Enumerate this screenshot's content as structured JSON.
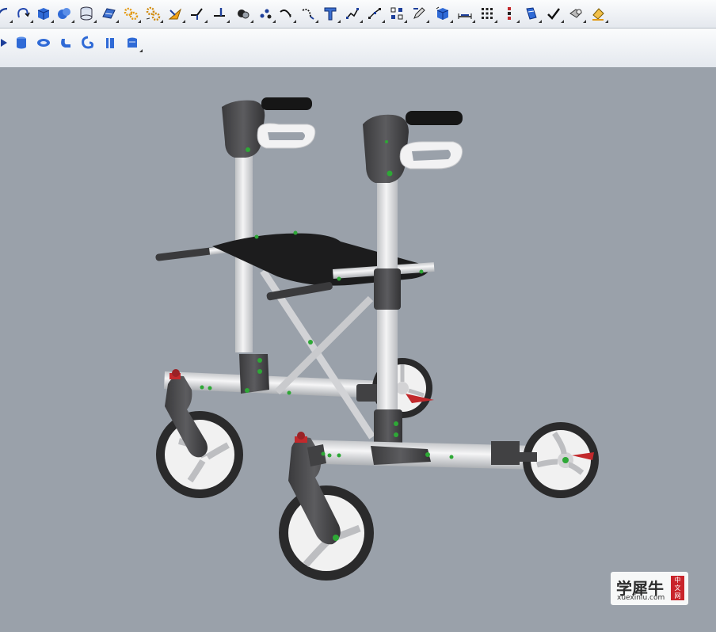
{
  "toolbar_top": {
    "tools": [
      {
        "icon": "curve-tool-icon"
      },
      {
        "icon": "revolve-icon"
      },
      {
        "icon": "box-solid-icon"
      },
      {
        "icon": "boolean-union-icon"
      },
      {
        "icon": "cylinder-solid-icon"
      },
      {
        "icon": "surface-edit-icon"
      },
      {
        "icon": "gear-transform-icon"
      },
      {
        "icon": "gear-array-icon"
      },
      {
        "icon": "fillet-edge-icon"
      },
      {
        "icon": "split-icon"
      },
      {
        "icon": "trim-icon"
      },
      {
        "icon": "boolean-difference-icon"
      },
      {
        "icon": "points-icon"
      },
      {
        "icon": "arc-icon"
      },
      {
        "icon": "blend-curve-icon"
      },
      {
        "icon": "text-object-icon"
      },
      {
        "icon": "polyline-icon"
      },
      {
        "icon": "control-points-icon"
      },
      {
        "icon": "grid-snap-icon"
      },
      {
        "icon": "pencil-edit-icon"
      },
      {
        "icon": "mesh-box-icon"
      },
      {
        "icon": "dimension-icon"
      },
      {
        "icon": "array-grid-icon"
      },
      {
        "icon": "array-linear-icon"
      },
      {
        "icon": "analyze-icon"
      },
      {
        "icon": "check-icon"
      },
      {
        "icon": "render-icon"
      },
      {
        "icon": "paint-bucket-icon"
      }
    ]
  },
  "toolbar_bottom": {
    "tools": [
      {
        "icon": "arrow-right-icon"
      },
      {
        "icon": "cylinder-icon"
      },
      {
        "icon": "ellipse-icon"
      },
      {
        "icon": "pipe-icon"
      },
      {
        "icon": "spiral-icon"
      },
      {
        "icon": "extrude-icon"
      },
      {
        "icon": "surface-icon"
      }
    ]
  },
  "viewport": {
    "model": "rollator-walker",
    "colors": {
      "background": "#9aa1aa",
      "frame": "#e6e7e9",
      "joint": "#4a4a4c",
      "seat": "#1c1c1d",
      "grip": "#161616",
      "accent_green": "#2ea836",
      "accent_red": "#c2292c",
      "tire": "#2a2a2b",
      "rim": "#f1f1f1"
    }
  },
  "watermark": {
    "brand": "学犀牛",
    "seal": [
      "中",
      "文",
      "网"
    ],
    "url": "xuexiniu.com"
  }
}
